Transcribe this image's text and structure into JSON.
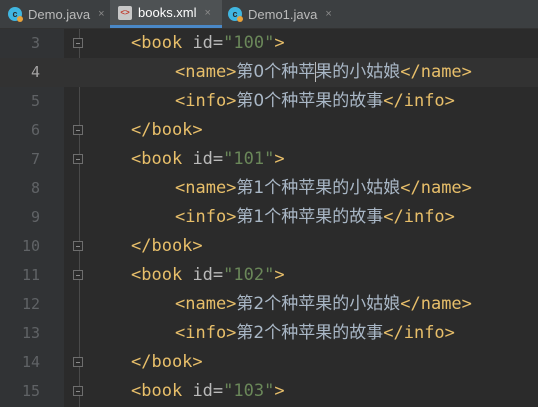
{
  "tabs": [
    {
      "label": "Demo.java",
      "icon": "java-class-icon"
    },
    {
      "label": "books.xml",
      "icon": "xml-file-icon"
    },
    {
      "label": "Demo1.java",
      "icon": "java-class-icon"
    }
  ],
  "close_glyph": "×",
  "lines": [
    {
      "n": "3"
    },
    {
      "n": "4"
    },
    {
      "n": "5"
    },
    {
      "n": "6"
    },
    {
      "n": "7"
    },
    {
      "n": "8"
    },
    {
      "n": "9"
    },
    {
      "n": "10"
    },
    {
      "n": "11"
    },
    {
      "n": "12"
    },
    {
      "n": "13"
    },
    {
      "n": "14"
    },
    {
      "n": "15"
    }
  ],
  "xml": {
    "book_open": "<book",
    "attr": "id",
    "eq": "=",
    "gt": ">",
    "book_close": "</book>",
    "name_open": "<name>",
    "name_close": "</name>",
    "info_open": "<info>",
    "info_close": "</info>",
    "ids": [
      "\"100\"",
      "\"101\"",
      "\"102\"",
      "\"103\""
    ],
    "names": [
      "第0个种苹果的小姑娘",
      "第1个种苹果的小姑娘",
      "第2个种苹果的小姑娘"
    ],
    "name0_a": "第0个种苹",
    "name0_b": "果的小姑娘",
    "infos": [
      "第0个种苹果的故事",
      "第1个种苹果的故事",
      "第2个种苹果的故事"
    ]
  },
  "colors": {
    "tag": "#e8bf6a",
    "attribute_value": "#6a8759",
    "text": "#a9b7c6",
    "background": "#2b2b2b"
  }
}
